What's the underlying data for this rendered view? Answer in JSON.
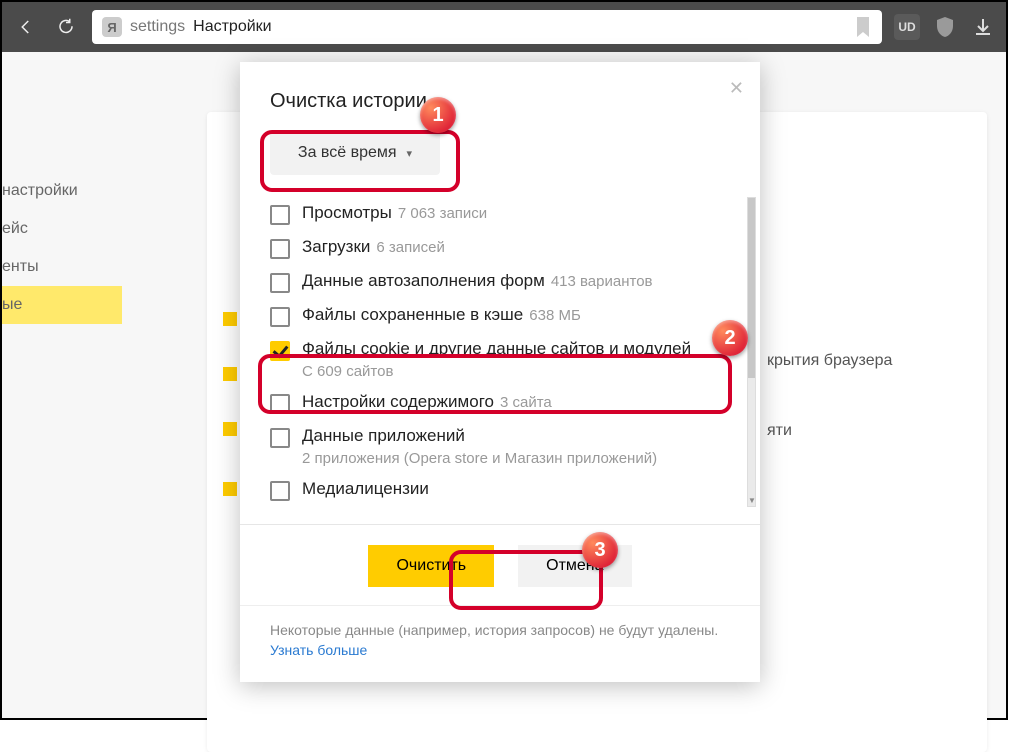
{
  "toolbar": {
    "addr_prefix": "settings",
    "addr_page": "Настройки",
    "ext_badge": "UD"
  },
  "sidebar": {
    "items": [
      "настройки",
      "ейс",
      "енты",
      "ые"
    ]
  },
  "bg": {
    "right1": "крытия браузера",
    "right2": "яти"
  },
  "modal": {
    "title": "Очистка истории",
    "time_label": "За всё время",
    "items": [
      {
        "label": "Просмотры",
        "sub_inline": "7 063 записи",
        "checked": false
      },
      {
        "label": "Загрузки",
        "sub_inline": "6 записей",
        "checked": false
      },
      {
        "label": "Данные автозаполнения форм",
        "sub_inline": "413 вариантов",
        "checked": false
      },
      {
        "label": "Файлы сохраненные в кэше",
        "sub_inline": "638 МБ",
        "checked": false
      },
      {
        "label": "Файлы cookie и другие данные сайтов и модулей",
        "sub_block": "С 609 сайтов",
        "checked": true
      },
      {
        "label": "Настройки содержимого",
        "sub_inline": "3 сайта",
        "checked": false
      },
      {
        "label": "Данные приложений",
        "sub_block": "2 приложения (Opera store и Магазин приложений)",
        "checked": false
      },
      {
        "label": "Медиалицензии",
        "checked": false
      }
    ],
    "clear": "Очистить",
    "cancel": "Отмена",
    "notice": "Некоторые данные (например, история запросов) не будут удалены.",
    "learn_more": "Узнать больше"
  },
  "badges": {
    "b1": "1",
    "b2": "2",
    "b3": "3"
  }
}
